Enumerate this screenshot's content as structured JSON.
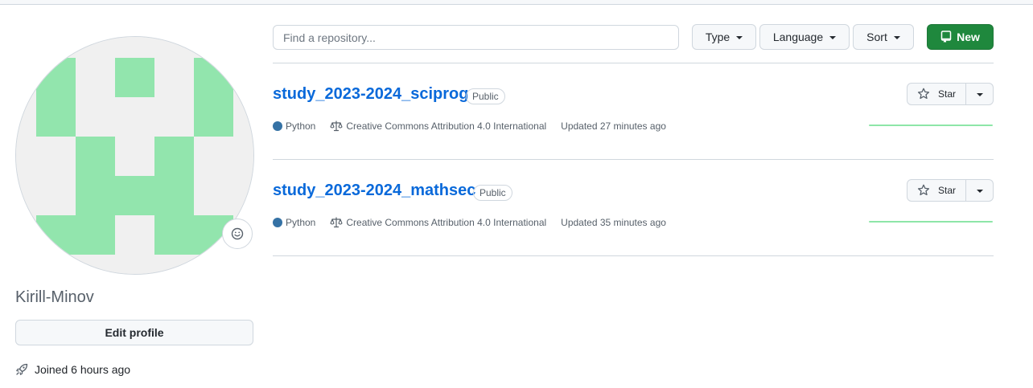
{
  "profile": {
    "username": "Kirill-Minov",
    "edit_label": "Edit profile",
    "joined": "Joined 6 hours ago",
    "avatar_color": "#92e5ad"
  },
  "toolbar": {
    "search_placeholder": "Find a repository...",
    "type_label": "Type",
    "language_label": "Language",
    "sort_label": "Sort",
    "new_label": "New",
    "new_color": "#1f883d"
  },
  "repos": [
    {
      "name": "study_2023-2024_sciprog",
      "visibility": "Public",
      "language": "Python",
      "language_color": "#3572a5",
      "license": "Creative Commons Attribution 4.0 International",
      "updated": "Updated 27 minutes ago",
      "star_label": "Star"
    },
    {
      "name": "study_2023-2024_mathsec",
      "visibility": "Public",
      "language": "Python",
      "language_color": "#3572a5",
      "license": "Creative Commons Attribution 4.0 International",
      "updated": "Updated 35 minutes ago",
      "star_label": "Star"
    }
  ],
  "icons": [
    "smiley-icon",
    "rocket-icon",
    "repo-icon",
    "law-icon",
    "star-icon",
    "triangle-down-icon"
  ]
}
